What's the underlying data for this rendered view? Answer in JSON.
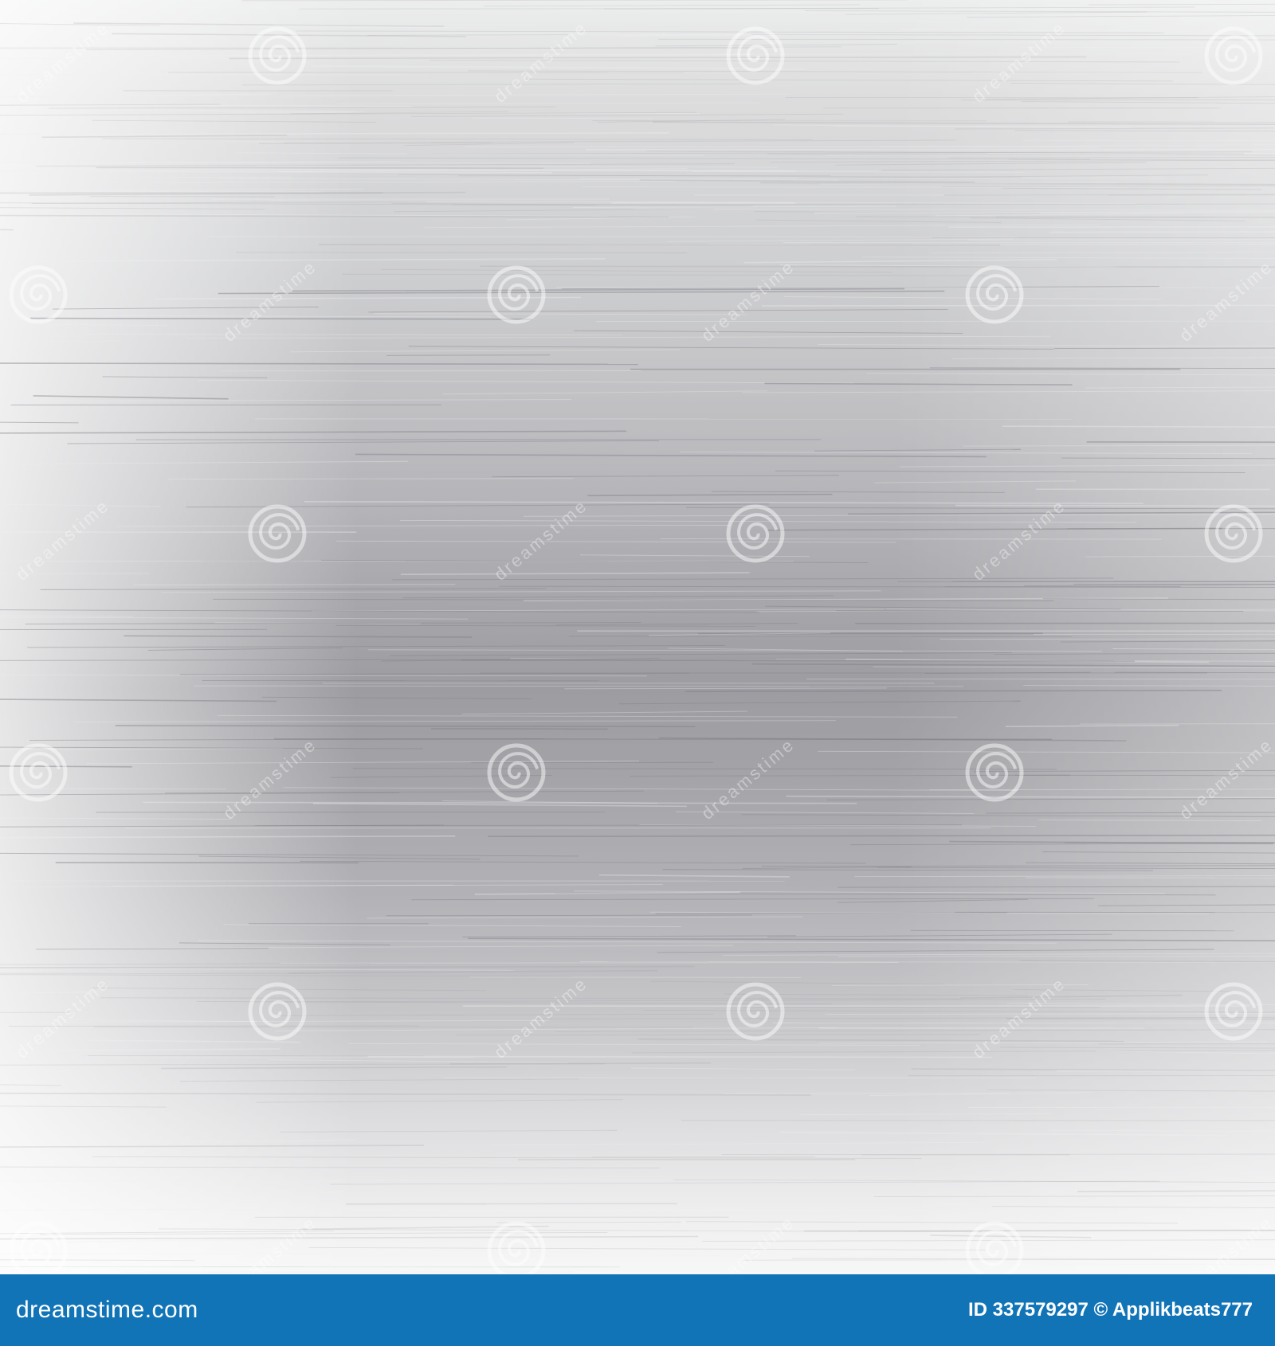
{
  "image": {
    "description_colors": {
      "light_silver": "#eeeeef",
      "mid_silver": "#b4b4b8",
      "dark_silver": "#9c9ca1",
      "footer_blue": "#1174b7"
    },
    "watermark_icon": "spiral-icon",
    "watermark_text": "dreamstime"
  },
  "footer": {
    "logo": "dreamstime.com",
    "id_text": "ID 337579297 © Applikbeats777"
  }
}
